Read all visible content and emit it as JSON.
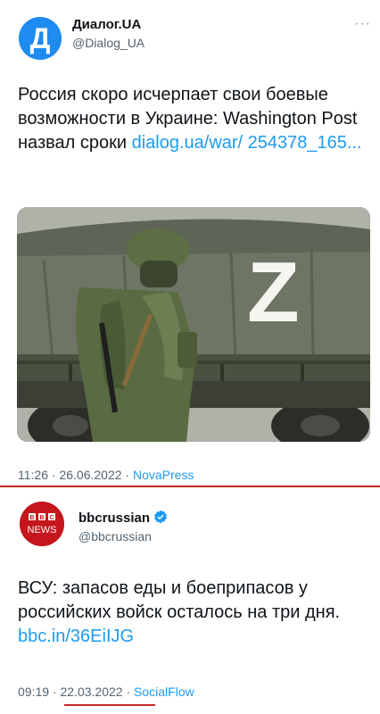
{
  "tweet1": {
    "author": "Диалог.UA",
    "handle": "@Dialog_UA",
    "avatar_letter": "Д",
    "more": "···",
    "text": "Россия скоро исчерпает свои боевые возможности в Украине: Washington Post назвал сроки",
    "link": "dialog.ua/war/ 254378_165...",
    "time": "11:26",
    "date": "26.06.2022",
    "source": "NovaPress",
    "image_letter": "Z"
  },
  "tweet2": {
    "author": "bbcrussian",
    "handle": "@bbcrussian",
    "avatar_top": "BBC",
    "avatar_bottom": "NEWS",
    "verified_icon": "verified-badge-icon",
    "text": "ВСУ: запасов еды и боеприпасов у российских войск осталось на три дня.",
    "link": "bbc.in/36EiIJG",
    "time": "09:19",
    "date": "22.03.2022",
    "source": "SocialFlow"
  },
  "colors": {
    "link": "#1d9bf0",
    "divider": "#c62828",
    "dialog_avatar": "#1d8bf0",
    "bbc_avatar": "#c4161c"
  }
}
